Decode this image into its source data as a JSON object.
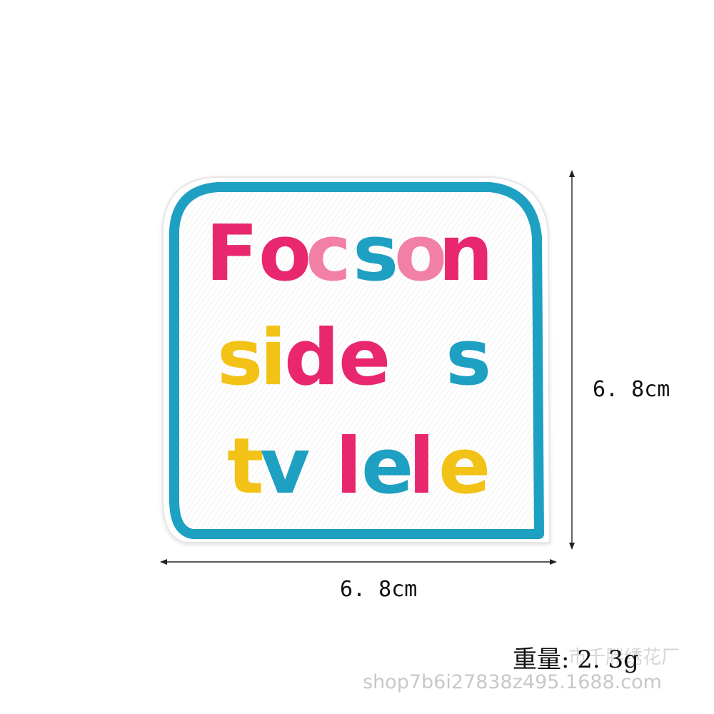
{
  "patch": {
    "lines": [
      [
        {
          "text": "F",
          "color": "#e8276f"
        },
        {
          "text": "o",
          "color": "#e8276f"
        },
        {
          "text": "c",
          "color": "#f27fa6"
        },
        {
          "text": "s",
          "color": "#1ea0c2"
        },
        {
          "text": "o",
          "color": "#f27fa6"
        },
        {
          "text": "n",
          "color": "#e8276f"
        }
      ],
      [
        {
          "text": "s",
          "color": "#f3c217"
        },
        {
          "text": "i",
          "color": "#f3c217"
        },
        {
          "text": "d",
          "color": "#e8276f"
        },
        {
          "text": "e",
          "color": "#e8276f"
        },
        {
          "text": "s",
          "color": "#1ea0c2"
        }
      ],
      [
        {
          "text": "t",
          "color": "#f3c217"
        },
        {
          "text": "v",
          "color": "#1ea0c2"
        },
        {
          "text": "l",
          "color": "#e8276f"
        },
        {
          "text": "e",
          "color": "#1ea0c2"
        },
        {
          "text": "l",
          "color": "#e8276f"
        },
        {
          "text": "e",
          "color": "#f3c217"
        }
      ]
    ],
    "border_color": "#1ea0c2",
    "fabric_color": "#ffffff"
  },
  "dimensions": {
    "height_label": "6. 8cm",
    "width_label": "6. 8cm"
  },
  "weight_label": "重量: 2. 3g",
  "watermark_cn": "市千胖绣花厂",
  "watermark": "shop7b6i27838z495.1688.com"
}
